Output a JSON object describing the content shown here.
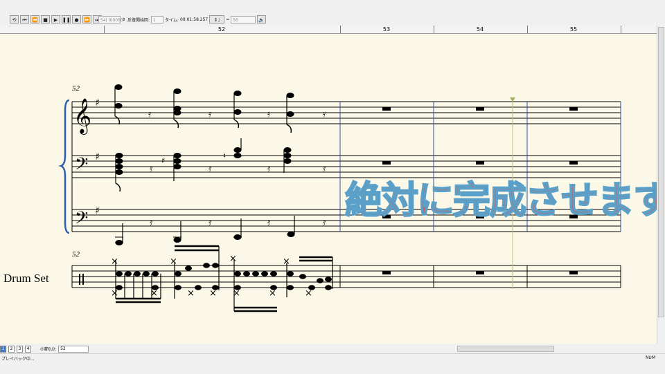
{
  "toolbar": {
    "position_readout": "54| 0|0050",
    "repeat_label": "反復開始回:",
    "repeat_value": "1",
    "time_label": "タイム:",
    "time_value": "00:01:58.257",
    "tempo_eq": "=",
    "tempo_value": "50",
    "transport_buttons": [
      "loop",
      "rewind-start",
      "rewind",
      "stop",
      "play",
      "pause",
      "record",
      "fast-forward",
      "forward-end"
    ]
  },
  "ruler": {
    "measures": [
      "52",
      "53",
      "54",
      "55"
    ]
  },
  "score": {
    "measure_number_top": "52",
    "measure_number_drums": "52",
    "instrument_label": "Drum Set"
  },
  "overlay_text": "絶対に完成させます",
  "bottom": {
    "pages": [
      "1",
      "2",
      "3",
      "4"
    ],
    "bar_label": "小節(U):",
    "bar_value": "52"
  },
  "status": {
    "text": "プレイバック中...",
    "num": "NUM"
  }
}
